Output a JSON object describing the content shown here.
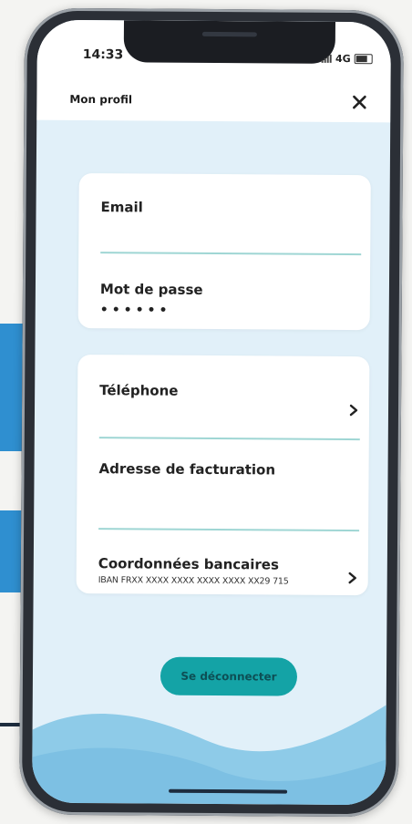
{
  "status_bar": {
    "time": "14:33",
    "network": "4G"
  },
  "header": {
    "title": "Mon profil",
    "close_icon": "close-icon"
  },
  "account_card": {
    "email_label": "Email",
    "password_label": "Mot de passe",
    "password_value": "••••••"
  },
  "details_card": {
    "phone_label": "Téléphone",
    "billing_label": "Adresse de facturation",
    "bank_label": "Coordonnées bancaires",
    "bank_value": "IBAN FRXX XXXX XXXX XXXX XXXX XX29 715"
  },
  "actions": {
    "logout_label": "Se déconnecter"
  },
  "colors": {
    "accent": "#14a3a6",
    "background": "#e1f0f9",
    "wave": "#8ecbe8",
    "divider": "#9fd6d4"
  }
}
